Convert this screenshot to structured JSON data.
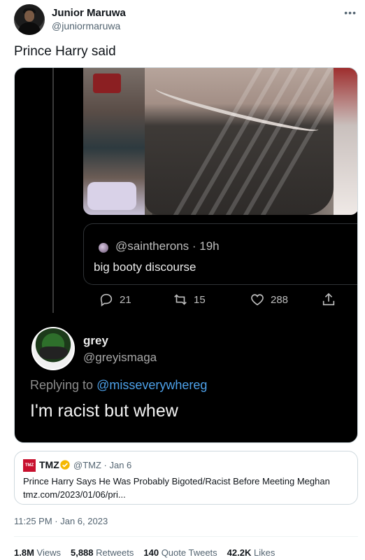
{
  "author": {
    "name": "Junior Maruwa",
    "handle": "@juniormaruwa"
  },
  "more_icon": "more-horizontal-icon",
  "tweet_text": "Prince Harry said",
  "embedded_screenshot": {
    "quoted_handle": "@saintherons · 19h",
    "quoted_body": "big booty discourse",
    "actions": {
      "replies": "21",
      "retweets": "15",
      "likes": "288"
    },
    "reply": {
      "name": "grey",
      "handle": "@greyismaga",
      "replying_prefix": "Replying to ",
      "replying_mention": "@misseverywhereg",
      "text": "I'm racist but whew"
    },
    "colors": {
      "background": "#000000",
      "mention": "#4da0e8"
    }
  },
  "quoted_tweet": {
    "logo_text": "TMZ",
    "name": "TMZ",
    "meta": "@TMZ · Jan 6",
    "text": "Prince Harry Says He Was Probably Bigoted/Racist Before Meeting Meghan",
    "link": "tmz.com/2023/01/06/pri..."
  },
  "timestamp": "11:25 PM · Jan 6, 2023",
  "stats": {
    "views_count": "1.8M",
    "views_label": "Views",
    "retweets_count": "5,888",
    "retweets_label": "Retweets",
    "quotes_count": "140",
    "quotes_label": "Quote Tweets",
    "likes_count": "42.2K",
    "likes_label": "Likes"
  },
  "colors": {
    "text": "#0f1419",
    "secondary": "#536471",
    "verified": "#f5b800",
    "tmz_red": "#c8102e"
  }
}
